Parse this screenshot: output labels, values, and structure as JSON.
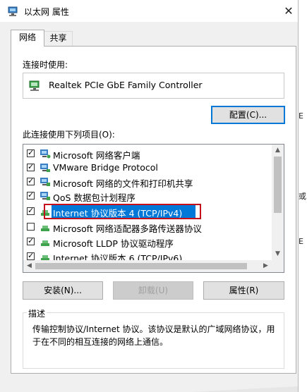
{
  "window": {
    "title": "以太网 属性",
    "close_glyph": "✕"
  },
  "tabs": [
    {
      "label": "网络",
      "active": true
    },
    {
      "label": "共享",
      "active": false
    }
  ],
  "connect_using_label": "连接时使用:",
  "adapter": {
    "name": "Realtek PCIe GbE Family Controller",
    "icon": "network-adapter-icon"
  },
  "configure_button": "配置(C)...",
  "items_label": "此连接使用下列项目(O):",
  "items": [
    {
      "label": "Microsoft 网络客户端",
      "checked": true,
      "icon": "network-client-icon"
    },
    {
      "label": "VMware Bridge Protocol",
      "checked": true,
      "icon": "network-protocol-icon"
    },
    {
      "label": "Microsoft 网络的文件和打印机共享",
      "checked": true,
      "icon": "network-service-icon"
    },
    {
      "label": "QoS 数据包计划程序",
      "checked": true,
      "icon": "network-service-icon"
    },
    {
      "label": "Internet 协议版本 4 (TCP/IPv4)",
      "checked": true,
      "selected": true,
      "icon": "protocol-icon"
    },
    {
      "label": "Microsoft 网络适配器多路传送器协议",
      "checked": false,
      "icon": "protocol-icon"
    },
    {
      "label": "Microsoft LLDP 协议驱动程序",
      "checked": true,
      "icon": "protocol-icon"
    },
    {
      "label": "Internet 协议版本 6 (TCP/IPv6)",
      "checked": true,
      "icon": "protocol-icon"
    }
  ],
  "buttons": {
    "install": "安装(N)...",
    "uninstall": "卸载(U)",
    "properties": "属性(R)"
  },
  "description": {
    "legend": "描述",
    "text": "传输控制协议/Internet 协议。该协议是默认的广域网络协议，用于在不同的相互连接的网络上通信。"
  },
  "background_fragments": [
    "E",
    "或",
    "E"
  ],
  "colors": {
    "selection": "#0078d7",
    "highlight_box": "#c4101c",
    "focus_border": "#0078d7"
  }
}
